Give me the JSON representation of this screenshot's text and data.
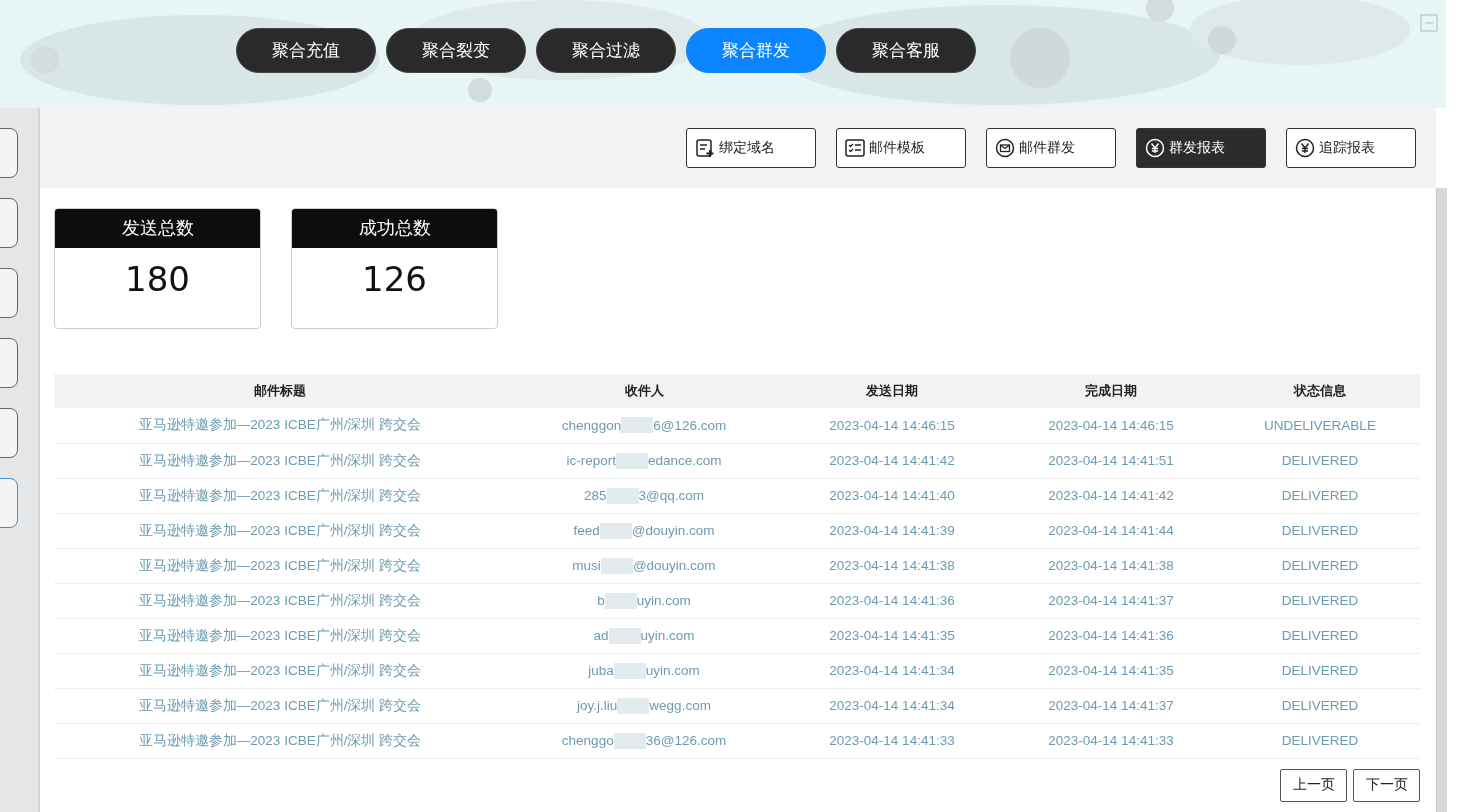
{
  "nav_tabs": [
    {
      "label": "聚合充值",
      "selected": false
    },
    {
      "label": "聚合裂变",
      "selected": false
    },
    {
      "label": "聚合过滤",
      "selected": false
    },
    {
      "label": "聚合群发",
      "selected": true
    },
    {
      "label": "聚合客服",
      "selected": false
    }
  ],
  "sidebar": {
    "items": [
      {
        "selected": false
      },
      {
        "selected": false
      },
      {
        "selected": false
      },
      {
        "selected": false
      },
      {
        "selected": false
      },
      {
        "selected": true
      }
    ]
  },
  "toolbar": [
    {
      "label": "绑定域名",
      "kind": "domain",
      "selected": false
    },
    {
      "label": "邮件模板",
      "kind": "template",
      "selected": false
    },
    {
      "label": "邮件群发",
      "kind": "mail",
      "selected": false
    },
    {
      "label": "群发报表",
      "kind": "yen",
      "selected": true
    },
    {
      "label": "追踪报表",
      "kind": "yen",
      "selected": false
    }
  ],
  "stats": [
    {
      "label": "发送总数",
      "value": "180"
    },
    {
      "label": "成功总数",
      "value": "126"
    }
  ],
  "table": {
    "columns": [
      "邮件标题",
      "收件人",
      "发送日期",
      "完成日期",
      "状态信息"
    ],
    "rows": [
      {
        "subject": "亚马逊特邀参加—2023 ICBE广州/深圳 跨交会",
        "recipient_start": "chenggon",
        "recipient_end": "6@126.com",
        "sent": "2023-04-14 14:46:15",
        "completed": "2023-04-14 14:46:15",
        "status": "UNDELIVERABLE"
      },
      {
        "subject": "亚马逊特邀参加—2023 ICBE广州/深圳 跨交会",
        "recipient_start": "ic-report",
        "recipient_end": "edance.com",
        "sent": "2023-04-14 14:41:42",
        "completed": "2023-04-14 14:41:51",
        "status": "DELIVERED"
      },
      {
        "subject": "亚马逊特邀参加—2023 ICBE广州/深圳 跨交会",
        "recipient_start": "285",
        "recipient_end": "3@qq.com",
        "sent": "2023-04-14 14:41:40",
        "completed": "2023-04-14 14:41:42",
        "status": "DELIVERED"
      },
      {
        "subject": "亚马逊特邀参加—2023 ICBE广州/深圳 跨交会",
        "recipient_start": "feed",
        "recipient_end": "@douyin.com",
        "sent": "2023-04-14 14:41:39",
        "completed": "2023-04-14 14:41:44",
        "status": "DELIVERED"
      },
      {
        "subject": "亚马逊特邀参加—2023 ICBE广州/深圳 跨交会",
        "recipient_start": "musi",
        "recipient_end": "@douyin.com",
        "sent": "2023-04-14 14:41:38",
        "completed": "2023-04-14 14:41:38",
        "status": "DELIVERED"
      },
      {
        "subject": "亚马逊特邀参加—2023 ICBE广州/深圳 跨交会",
        "recipient_start": "b",
        "recipient_end": "uyin.com",
        "sent": "2023-04-14 14:41:36",
        "completed": "2023-04-14 14:41:37",
        "status": "DELIVERED"
      },
      {
        "subject": "亚马逊特邀参加—2023 ICBE广州/深圳 跨交会",
        "recipient_start": "ad",
        "recipient_end": "uyin.com",
        "sent": "2023-04-14 14:41:35",
        "completed": "2023-04-14 14:41:36",
        "status": "DELIVERED"
      },
      {
        "subject": "亚马逊特邀参加—2023 ICBE广州/深圳 跨交会",
        "recipient_start": "juba",
        "recipient_end": "uyin.com",
        "sent": "2023-04-14 14:41:34",
        "completed": "2023-04-14 14:41:35",
        "status": "DELIVERED"
      },
      {
        "subject": "亚马逊特邀参加—2023 ICBE广州/深圳 跨交会",
        "recipient_start": "joy.j.liu",
        "recipient_end": "wegg.com",
        "sent": "2023-04-14 14:41:34",
        "completed": "2023-04-14 14:41:37",
        "status": "DELIVERED"
      },
      {
        "subject": "亚马逊特邀参加—2023 ICBE广州/深圳 跨交会",
        "recipient_start": "chenggo",
        "recipient_end": "36@126.com",
        "sent": "2023-04-14 14:41:33",
        "completed": "2023-04-14 14:41:33",
        "status": "DELIVERED"
      }
    ]
  },
  "pagination": {
    "prev": "上一页",
    "next": "下一页"
  }
}
